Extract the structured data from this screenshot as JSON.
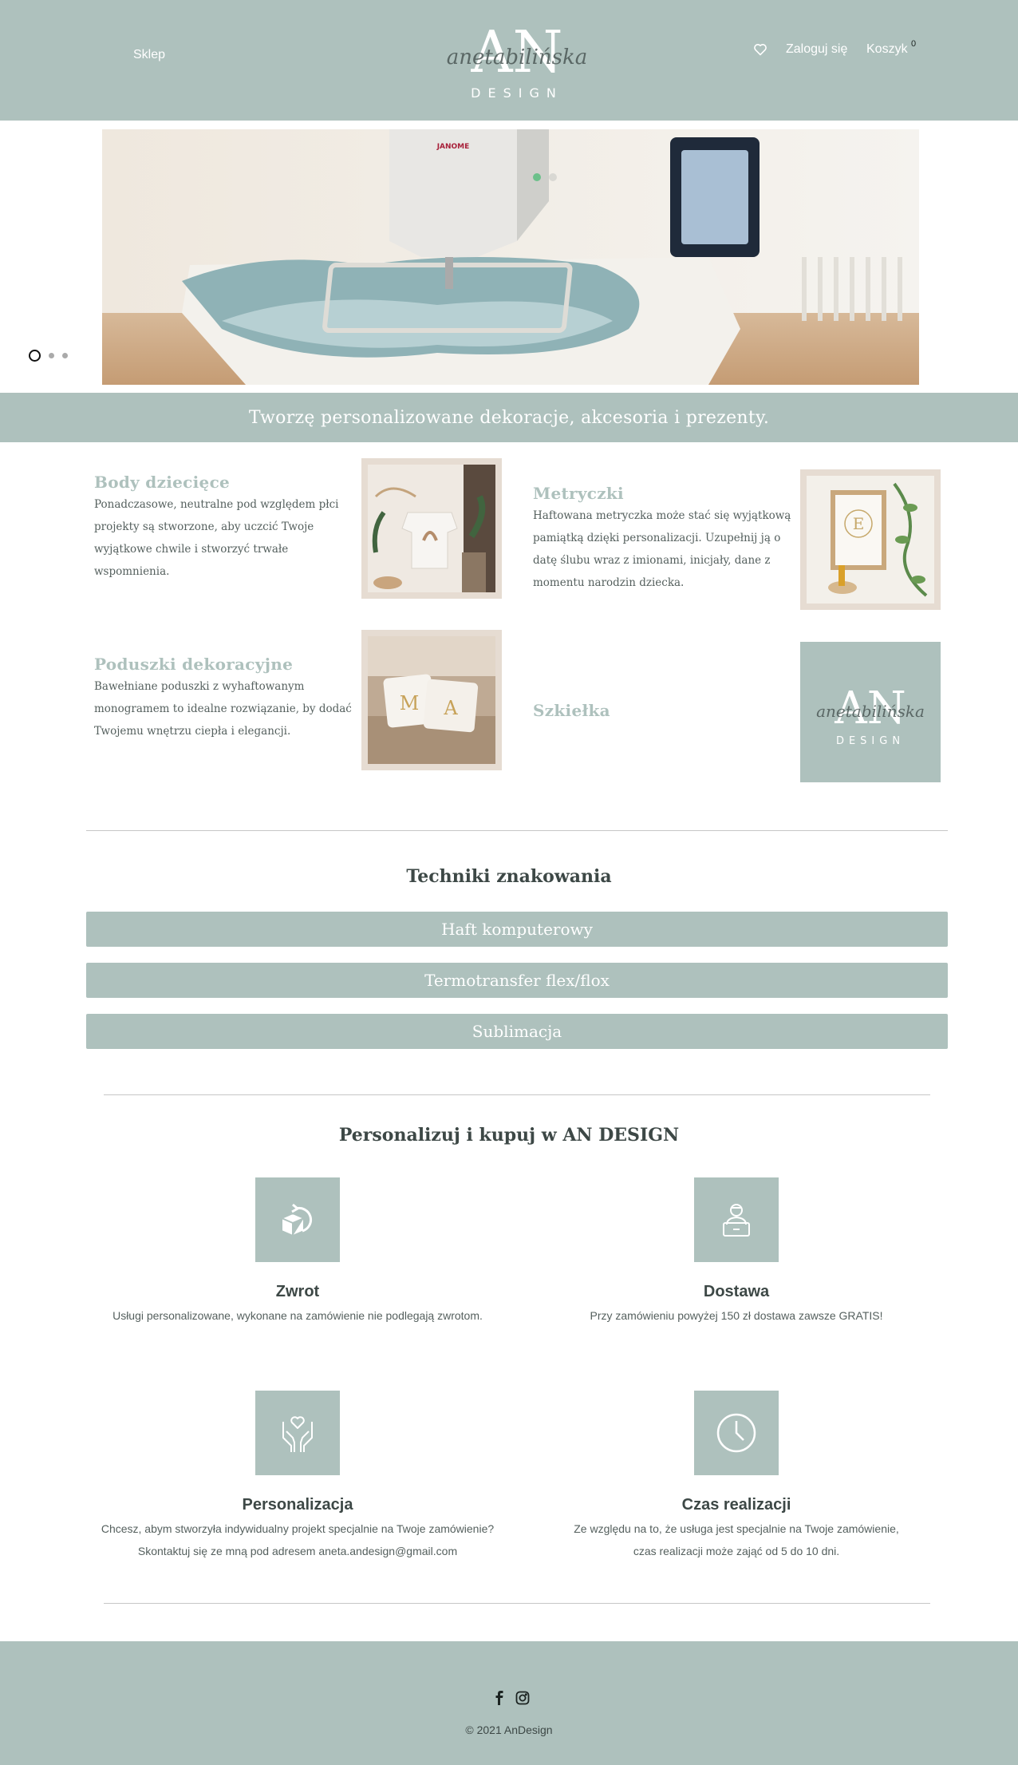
{
  "header": {
    "shop_label": "Sklep",
    "logo_script": "anetabilińska",
    "logo_initials": "AN",
    "logo_word": "DESIGN",
    "login_label": "Zaloguj się",
    "cart_label": "Koszyk",
    "cart_count": "0"
  },
  "hero": {
    "slider_pages": 3,
    "active_page": 1,
    "brand_text": "JANOME"
  },
  "tagline": "Tworzę personalizowane dekoracje, akcesoria i prezenty.",
  "categories": [
    {
      "title": "Body dziecięce",
      "lines": [
        "Ponadczasowe, neutralne pod względem płci",
        "projekty są stworzone, aby uczcić Twoje",
        "wyjątkowe chwile i stworzyć trwałe",
        "wspomnienia."
      ]
    },
    {
      "title": "Metryczki",
      "lines": [
        "Haftowana metryczka może stać się wyjątkową",
        "pamiątką dzięki personalizacji. Uzupełnij ją o",
        "datę ślubu wraz z imionami, inicjały, dane z",
        "momentu narodzin dziecka."
      ],
      "image_letter": "E"
    },
    {
      "title": "Poduszki dekoracyjne",
      "lines": [
        "Bawełniane poduszki z wyhaftowanym",
        "monogramem to idealne rozwiązanie, by dodać",
        "Twojemu wnętrzu ciepła i elegancji."
      ],
      "image_letters": [
        "M",
        "A"
      ]
    },
    {
      "title": "Szkiełka",
      "lines": []
    }
  ],
  "techniques": {
    "title": "Techniki znakowania",
    "items": [
      "Haft komputerowy",
      "Termotransfer flex/flox",
      "Sublimacja"
    ]
  },
  "features": {
    "title": "Personalizuj i kupuj w AN DESIGN",
    "items": [
      {
        "icon": "return-box-icon",
        "title": "Zwrot",
        "lines": [
          "Usługi personalizowane, wykonane na zamówienie nie podlegają zwrotom."
        ]
      },
      {
        "icon": "delivery-person-icon",
        "title": "Dostawa",
        "lines": [
          "Przy zamówieniu powyżej 150 zł dostawa zawsze GRATIS!"
        ]
      },
      {
        "icon": "hands-heart-icon",
        "title": "Personalizacja",
        "lines": [
          "Chcesz, abym stworzyła indywidualny projekt specjalnie na Twoje zamówienie?",
          "Skontaktuj się ze mną pod adresem aneta.andesign@gmail.com"
        ]
      },
      {
        "icon": "clock-icon",
        "title": "Czas realizacji",
        "lines": [
          "Ze względu na to, że usługa jest specjalnie na Twoje zamówienie,",
          "czas realizacji może zająć od 5 do 10 dni."
        ]
      }
    ]
  },
  "footer": {
    "copyright": "© 2021 AnDesign"
  },
  "colors": {
    "brand": "#aec1bd",
    "text": "#3d4846",
    "frame": "#e6dcd2"
  }
}
